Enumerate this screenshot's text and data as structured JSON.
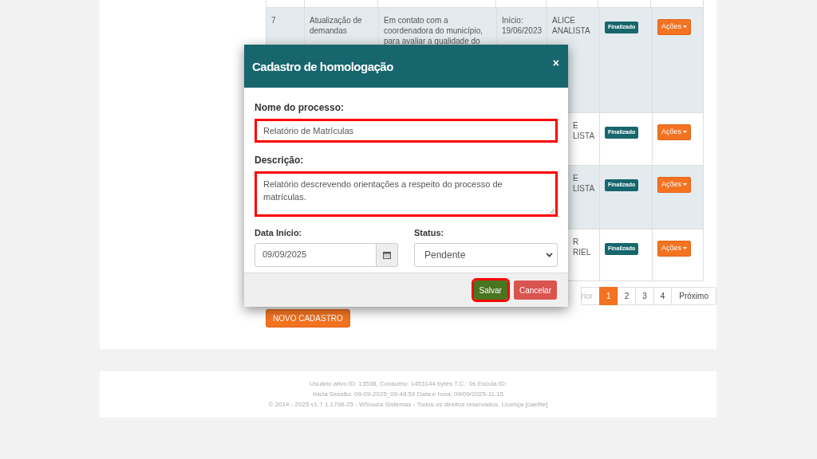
{
  "table": {
    "rows": [
      {
        "number": "7",
        "title": "Atualização de\ndemandas",
        "description": "Em contato com a\ncoordenadora do município,\npara avaliar a qualidade do",
        "date": "Início:\n19/06/2023",
        "responsible": "ALICE\nANALISTA",
        "status": "Finalizado",
        "actions": "Ações"
      },
      {
        "responsible": "E\nLISTA",
        "status": "Finalizado",
        "actions": "Ações"
      },
      {
        "responsible": "E\nLISTA",
        "status": "Finalizado",
        "actions": "Ações"
      },
      {
        "responsible": "R\nRIEL",
        "status": "Finalizado",
        "actions": "Ações"
      }
    ]
  },
  "pagination": [
    {
      "label": "rior",
      "selected": false
    },
    {
      "label": "1",
      "selected": true
    },
    {
      "label": "2",
      "selected": false
    },
    {
      "label": "3",
      "selected": false
    },
    {
      "label": "4",
      "selected": false
    },
    {
      "label": "Próximo",
      "selected": false
    }
  ],
  "new_button": "NOVO CADASTRO",
  "modal": {
    "title": "Cadastro de homologação",
    "close": "×",
    "name": {
      "label": "Nome do processo:",
      "value": "Relatório de Matrículas",
      "highlighted": true
    },
    "description": {
      "label": "Descrição:",
      "value": "Relatório descrevendo orientações a respeito do processo de matrículas.",
      "highlighted": true
    },
    "start_date": {
      "label": "Data Início:",
      "value": "09/09/2025"
    },
    "status": {
      "label": "Status:",
      "value": "Pendente"
    },
    "buttons": [
      {
        "kind": "save",
        "label": "Salvar",
        "highlighted": true
      },
      {
        "kind": "cancel",
        "label": "Cancelar",
        "highlighted": false
      }
    ]
  },
  "footer": [
    "Usuário ativo ID: 13538, Consumo: 1453144 bytes T.C.: 0s Escola ID:",
    "Inicia Sessão: 09-09-2025_09:48:59 Data e hora: 09/09/2025-11:15",
    "© 2014 - 2025 v1.7.1.1706-25 - WSouza Sistemas - Todos os direitos reservados. Licença [caetite]"
  ]
}
